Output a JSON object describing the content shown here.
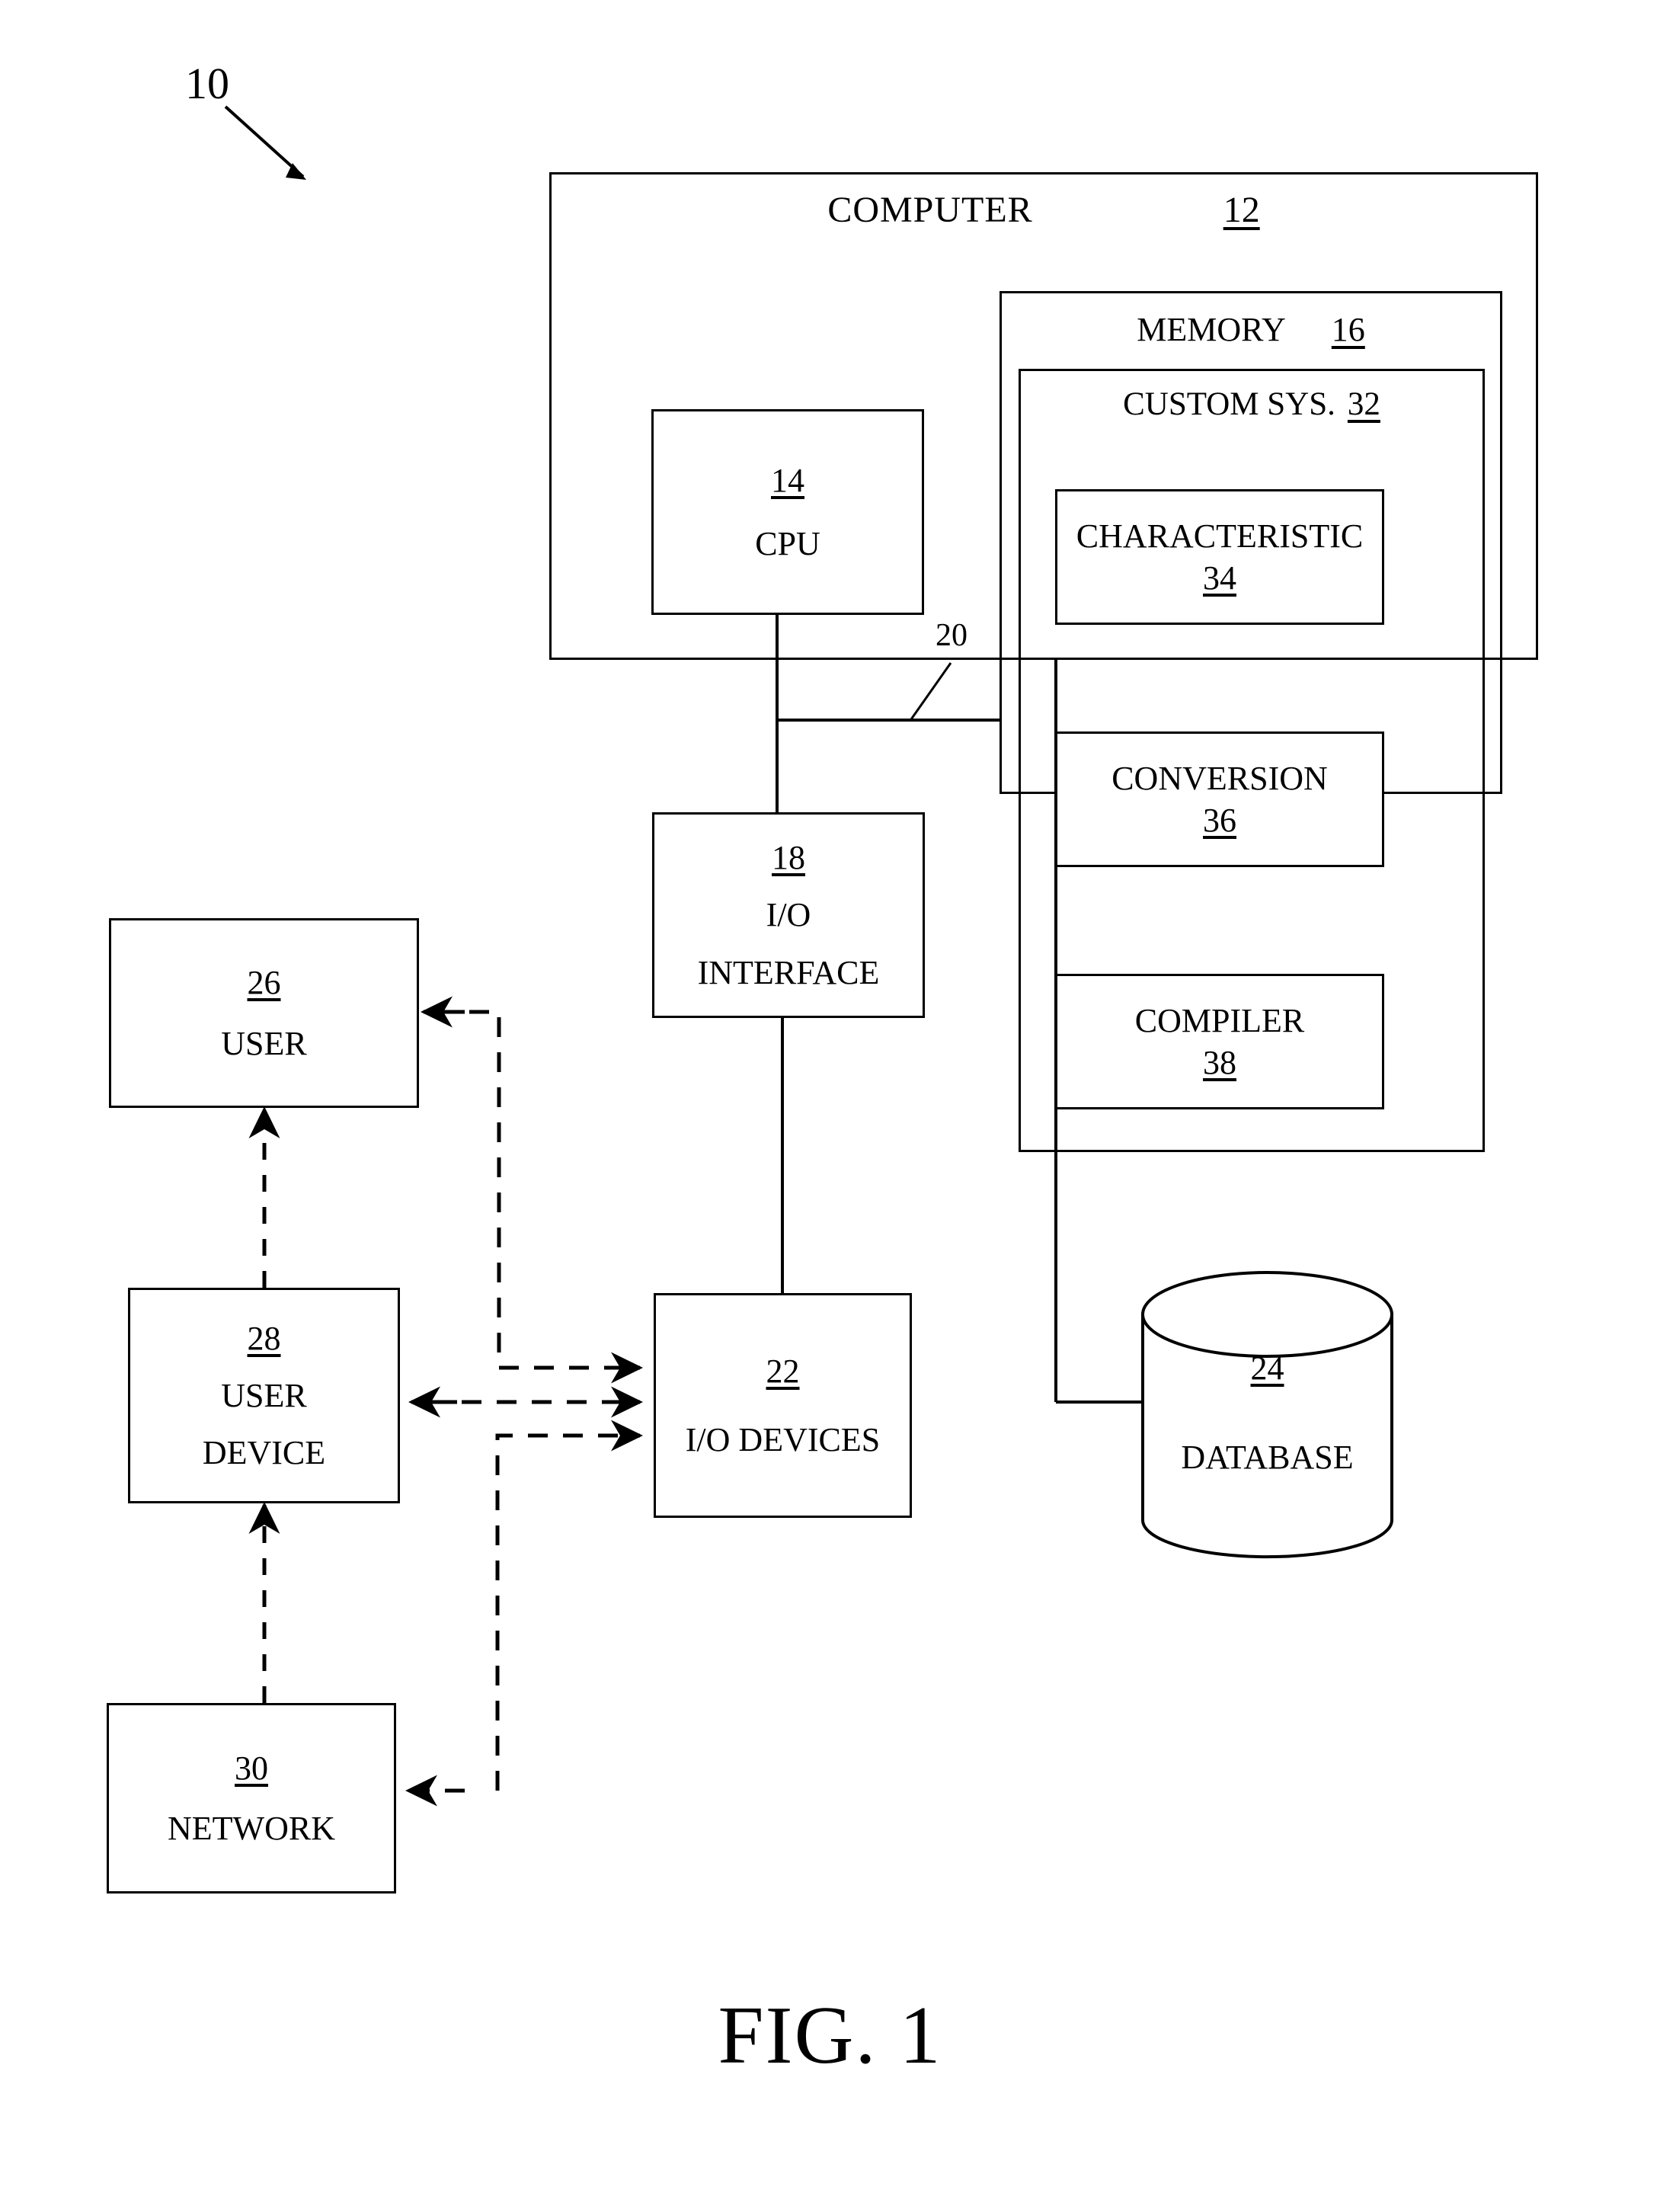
{
  "figure": {
    "caption": "FIG. 1",
    "system_ref": "10",
    "bus_ref": "20"
  },
  "computer": {
    "title": "COMPUTER",
    "num": "12",
    "cpu": {
      "num": "14",
      "label": "CPU"
    },
    "io_interface": {
      "num": "18",
      "label_line1": "I/O",
      "label_line2": "INTERFACE"
    },
    "memory": {
      "title": "MEMORY",
      "num": "16",
      "custom_system": {
        "title": "CUSTOM SYS.",
        "num": "32",
        "blocks": [
          {
            "label": "CHARACTERISTIC",
            "num": "34"
          },
          {
            "label": "CONVERSION",
            "num": "36"
          },
          {
            "label": "COMPILER",
            "num": "38"
          }
        ]
      }
    }
  },
  "external": {
    "io_devices": {
      "num": "22",
      "label": "I/O  DEVICES"
    },
    "database": {
      "num": "24",
      "label": "DATABASE"
    },
    "user": {
      "num": "26",
      "label": "USER"
    },
    "user_device": {
      "num": "28",
      "label_line1": "USER",
      "label_line2": "DEVICE"
    },
    "network": {
      "num": "30",
      "label": "NETWORK"
    }
  },
  "style": {
    "line_color": "#000000",
    "background": "#ffffff"
  }
}
